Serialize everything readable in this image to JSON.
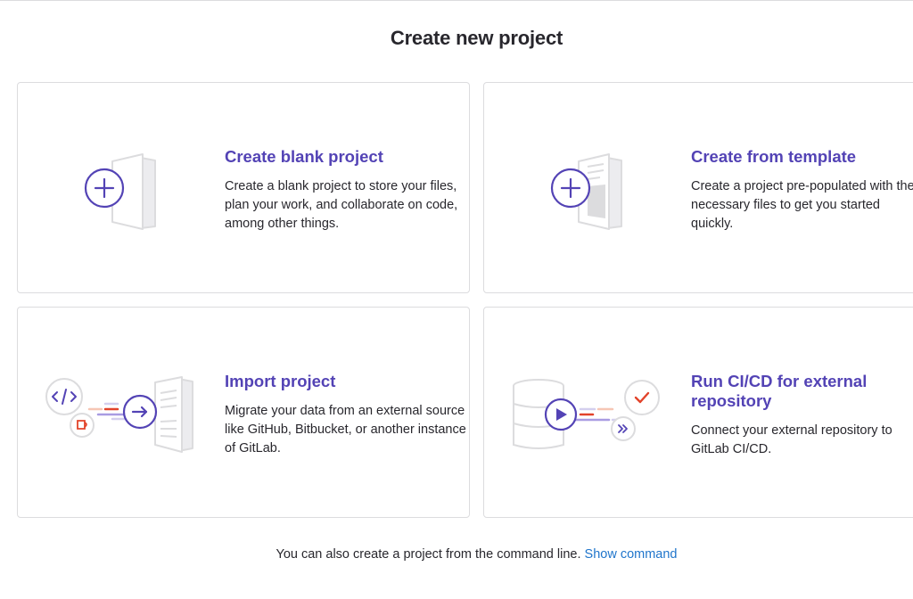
{
  "page": {
    "title": "Create new project"
  },
  "cards": [
    {
      "title": "Create blank project",
      "description": "Create a blank project to store your files, plan your work, and collaborate on code, among other things.",
      "icon": "blank-project-illustration"
    },
    {
      "title": "Create from template",
      "description_lines": [
        "Create a project pre-populated with the",
        "necessary files to get you started",
        "quickly."
      ],
      "icon": "template-project-illustration"
    },
    {
      "title": "Import project",
      "description": "Migrate your data from an external source like GitHub, Bitbucket, or another instance of GitLab.",
      "icon": "import-project-illustration"
    },
    {
      "title": "Run CI/CD for external repository",
      "description": "Connect your external repository to GitLab CI/CD.",
      "icon": "cicd-external-illustration"
    }
  ],
  "footer": {
    "text": "You can also create a project from the command line.",
    "link_label": "Show command"
  },
  "colors": {
    "accent": "#5343b5",
    "link": "#1f75cb",
    "orange": "#e2432a",
    "border": "#dcdcde"
  }
}
